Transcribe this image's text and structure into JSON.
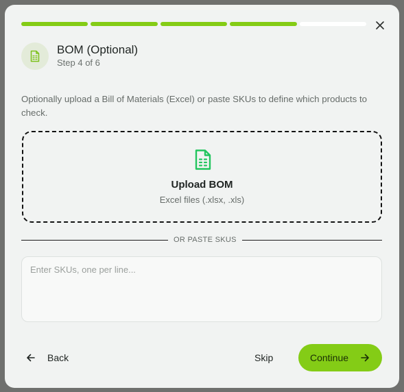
{
  "wizard": {
    "progress": {
      "total_steps": 6,
      "completed_steps": 4
    },
    "title": "BOM (Optional)",
    "step_label": "Step 4 of 6",
    "header_icon": "file-spreadsheet-icon",
    "description": "Optionally upload a Bill of Materials (Excel) or paste SKUs to define which products to check."
  },
  "upload": {
    "icon": "file-spreadsheet-icon",
    "title": "Upload BOM",
    "subtitle": "Excel files (.xlsx, .xls)"
  },
  "divider": {
    "label": "OR PASTE SKUS"
  },
  "sku_input": {
    "placeholder": "Enter SKUs, one per line...",
    "value": ""
  },
  "footer": {
    "back_label": "Back",
    "skip_label": "Skip",
    "continue_label": "Continue"
  },
  "colors": {
    "accent": "#84cc16",
    "icon_green": "#22c55e",
    "overlay": "#6f706e",
    "modal_bg": "#f1f3f2"
  }
}
